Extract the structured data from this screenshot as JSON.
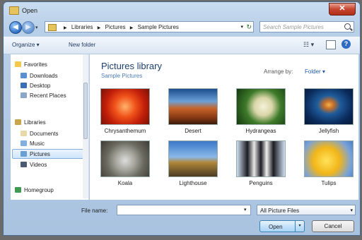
{
  "window": {
    "title": "Open",
    "close_glyph": "✕"
  },
  "nav": {
    "back_glyph": "◀",
    "forward_glyph": "▶",
    "breadcrumbs": [
      "Libraries",
      "Pictures",
      "Sample Pictures"
    ],
    "search_placeholder": "Search Sample Pictures"
  },
  "toolbar": {
    "organize": "Organize ▾",
    "new_folder": "New folder",
    "help": "?"
  },
  "sidebar": {
    "favorites": "Favorites",
    "favorites_items": [
      "Downloads",
      "Desktop",
      "Recent Places"
    ],
    "libraries": "Libraries",
    "libraries_items": [
      "Documents",
      "Music",
      "Pictures",
      "Videos"
    ],
    "homegroup": "Homegroup",
    "selected": "Pictures"
  },
  "content": {
    "title": "Pictures library",
    "subtitle": "Sample Pictures",
    "arrange_label": "Arrange by:",
    "arrange_value": "Folder ▾",
    "files": [
      {
        "name": "Chrysanthemum"
      },
      {
        "name": "Desert"
      },
      {
        "name": "Hydrangeas"
      },
      {
        "name": "Jellyfish"
      },
      {
        "name": "Koala"
      },
      {
        "name": "Lighthouse"
      },
      {
        "name": "Penguins"
      },
      {
        "name": "Tulips"
      }
    ]
  },
  "footer": {
    "file_name_label": "File name:",
    "file_name_value": "",
    "filter_value": "All Picture Files",
    "open_label": "Open",
    "cancel_label": "Cancel"
  },
  "colors": {
    "accent": "#2d6cc0",
    "title_blue": "#1d3f6e"
  }
}
